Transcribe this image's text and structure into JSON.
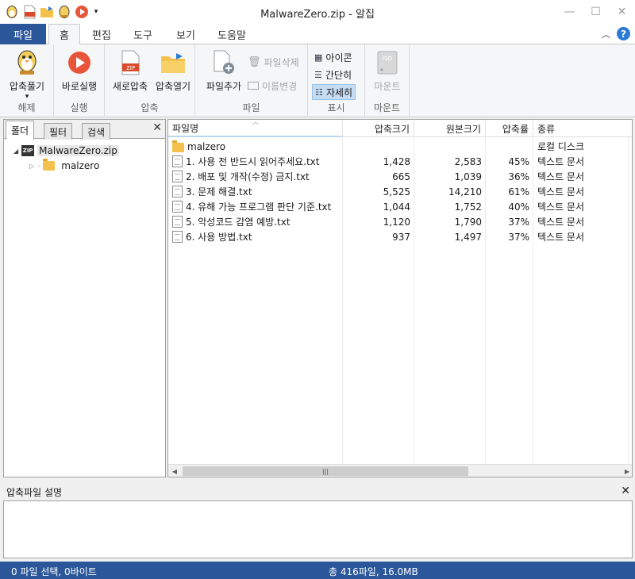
{
  "window": {
    "title": "MalwareZero.zip - 알집"
  },
  "ribbon_tabs": [
    "파일",
    "홈",
    "편집",
    "도구",
    "보기",
    "도움말"
  ],
  "ribbon": {
    "extract": {
      "button": "압축풀기",
      "group": "해제"
    },
    "run": {
      "button": "바로실행",
      "group": "실행"
    },
    "compress": {
      "new": "새로압축",
      "open": "압축열기",
      "group": "압축",
      "zip_badge": "ZIP"
    },
    "file": {
      "add": "파일추가",
      "delete": "파일삭제",
      "rename": "이름변경",
      "group": "파일"
    },
    "view": {
      "icons": "아이콘",
      "simple": "간단히",
      "detail": "자세히",
      "group": "표시"
    },
    "mount": {
      "button": "마운트",
      "group": "마운트",
      "iso_badge": "ISO"
    }
  },
  "left_panel": {
    "tabs": [
      "폴더",
      "필터",
      "검색"
    ],
    "tree": {
      "root": "MalwareZero.zip",
      "child": "malzero"
    }
  },
  "file_list": {
    "columns": [
      "파일명",
      "압축크기",
      "원본크기",
      "압축률",
      "종류"
    ],
    "rows": [
      {
        "name": "malzero",
        "packed": "",
        "original": "",
        "ratio": "",
        "type": "로컬 디스크",
        "icon": "folder-icon"
      },
      {
        "name": "1. 사용 전 반드시 읽어주세요.txt",
        "packed": "1,428",
        "original": "2,583",
        "ratio": "45%",
        "type": "텍스트 문서",
        "icon": "text-file-icon"
      },
      {
        "name": "2. 배포 및 개작(수정) 금지.txt",
        "packed": "665",
        "original": "1,039",
        "ratio": "36%",
        "type": "텍스트 문서",
        "icon": "text-file-icon"
      },
      {
        "name": "3. 문제 해결.txt",
        "packed": "5,525",
        "original": "14,210",
        "ratio": "61%",
        "type": "텍스트 문서",
        "icon": "text-file-icon"
      },
      {
        "name": "4. 유해 가능 프로그램 판단 기준.txt",
        "packed": "1,044",
        "original": "1,752",
        "ratio": "40%",
        "type": "텍스트 문서",
        "icon": "text-file-icon"
      },
      {
        "name": "5. 악성코드 감염 예방.txt",
        "packed": "1,120",
        "original": "1,790",
        "ratio": "37%",
        "type": "텍스트 문서",
        "icon": "text-file-icon"
      },
      {
        "name": "6. 사용 방법.txt",
        "packed": "937",
        "original": "1,497",
        "ratio": "37%",
        "type": "텍스트 문서",
        "icon": "text-file-icon"
      }
    ]
  },
  "description": {
    "title": "압축파일 설명"
  },
  "status": {
    "left": "0 파일 선택,  0바이트",
    "right": "총 416파일,  16.0MB"
  },
  "colors": {
    "accent": "#2b579a",
    "run_red": "#e8553a",
    "folder": "#f4c24c",
    "selected": "#c5dcf3"
  }
}
